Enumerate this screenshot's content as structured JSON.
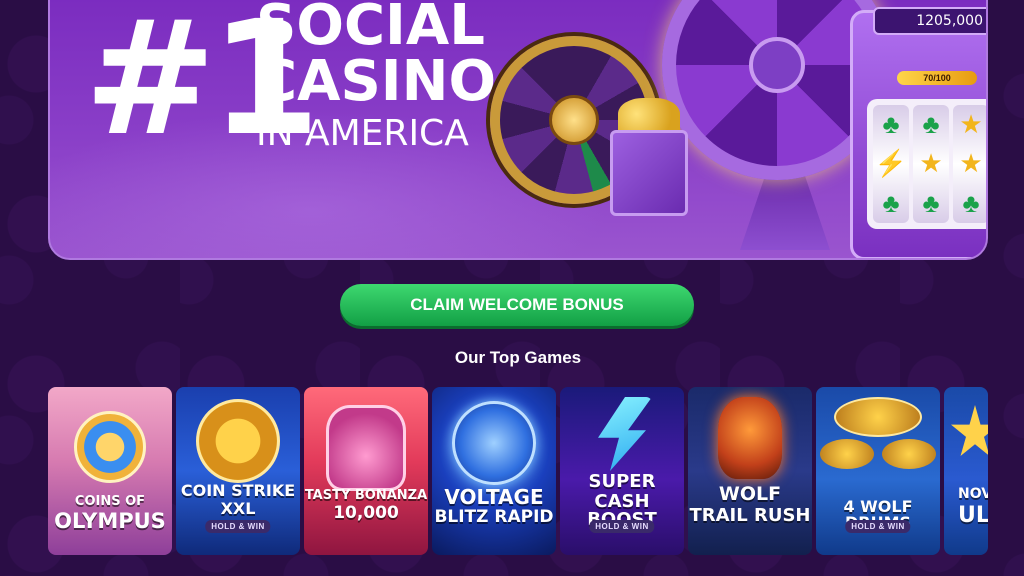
{
  "hero": {
    "headline_number": "#1",
    "headline_line1": "SOCIAL",
    "headline_line2": "CASINO",
    "headline_line3": "IN AMERICA",
    "slot_display": "1205,000",
    "slot_bar_label": "70/100"
  },
  "cta": {
    "label": "CLAIM WELCOME BONUS"
  },
  "section": {
    "title": "Our Top Games"
  },
  "games": [
    {
      "title_line1": "COINS OF",
      "title_line2": "OLYMPUS",
      "tag": ""
    },
    {
      "title_line1": "COIN STRIKE",
      "title_line2": "XXL",
      "tag": "HOLD & WIN"
    },
    {
      "title_line1": "TASTY BONANZA",
      "title_line2": "10,000",
      "tag": ""
    },
    {
      "title_line1": "VOLTAGE",
      "title_line2": "BLITZ RAPID",
      "tag": ""
    },
    {
      "title_line1": "SUPER",
      "title_line2": "CASH BOOST",
      "tag": "HOLD & WIN"
    },
    {
      "title_line1": "WOLF",
      "title_line2": "TRAIL RUSH",
      "tag": ""
    },
    {
      "title_line1": "4 WOLF DRUMS",
      "title_line2": "",
      "tag": "HOLD & WIN"
    },
    {
      "title_line1": "NOV",
      "title_line2": "UL",
      "tag": ""
    }
  ],
  "colors": {
    "background": "#2a0d45",
    "hero": "#8a3fc8",
    "cta": "#1fb855"
  }
}
